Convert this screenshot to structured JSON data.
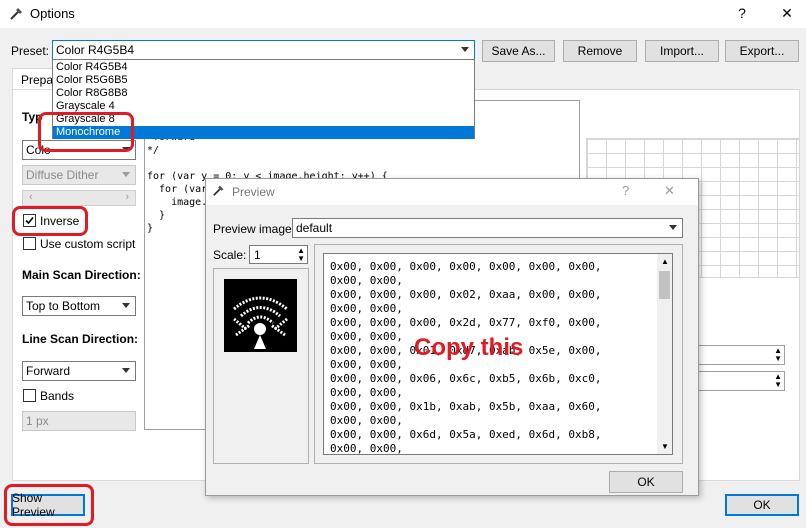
{
  "window": {
    "title": "Options",
    "help_label": "?",
    "close_label": "✕"
  },
  "preset": {
    "label": "Preset:",
    "value": "Color R4G5B4",
    "options": [
      "Color R4G5B4",
      "Color R5G6B5",
      "Color R8G8B8",
      "Grayscale 4",
      "Grayscale 8",
      "Monochrome"
    ],
    "selected_option": "Monochrome"
  },
  "toolbar": {
    "save_as": "Save As...",
    "remove": "Remove",
    "import": "Import...",
    "export": "Export..."
  },
  "tab": {
    "label": "Prepa"
  },
  "left": {
    "type_label": "Typ",
    "type_value": "Colo",
    "dither_value": "Diffuse Dither",
    "inverse_label": "Inverse",
    "inverse_checked": true,
    "custom_script_label": "Use custom script",
    "custom_script_checked": false,
    "main_scan_label": "Main Scan Direction:",
    "main_scan_value": "Top to Bottom",
    "line_scan_label": "Line Scan Direction:",
    "line_scan_value": "Forward",
    "bands_label": "Bands",
    "bands_checked": false,
    "band_size_value": "1 px"
  },
  "code": {
    "lines": [
      " forward",
      "*/",
      "",
      "for (var y = 0; y < image.height; y++) {",
      "  for (var x",
      "    image.",
      "  }",
      "}"
    ]
  },
  "preview": {
    "title": "Preview",
    "help_label": "?",
    "close_label": "✕",
    "image_label": "Preview image:",
    "image_value": "default",
    "scale_label": "Scale:",
    "scale_value": "1",
    "ok_label": "OK",
    "output_lines": [
      "0x00, 0x00, 0x00, 0x00, 0x00, 0x00, 0x00,",
      "0x00, 0x00,",
      "0x00, 0x00, 0x00, 0x02, 0xaa, 0x00, 0x00,",
      "0x00, 0x00,",
      "0x00, 0x00, 0x00, 0x2d, 0x77, 0xf0, 0x00,",
      "0x00, 0x00,",
      "0x00, 0x00, 0x01, 0xd7, 0xab, 0x5e, 0x00,",
      "0x00, 0x00,",
      "0x00, 0x00, 0x06, 0x6c, 0xb5, 0x6b, 0xc0,",
      "0x00, 0x00,",
      "0x00, 0x00, 0x1b, 0xab, 0x5b, 0xaa, 0x60,",
      "0x00, 0x00,",
      "0x00, 0x00, 0x6d, 0x5a, 0xed, 0x6d, 0xb8,",
      "0x00, 0x00,"
    ],
    "annotation": "Copy this"
  },
  "footer": {
    "show_preview": "Show Preview",
    "ok_label": "OK"
  },
  "colors": {
    "accent": "#0078d7",
    "annotation_red": "#e01b24"
  }
}
